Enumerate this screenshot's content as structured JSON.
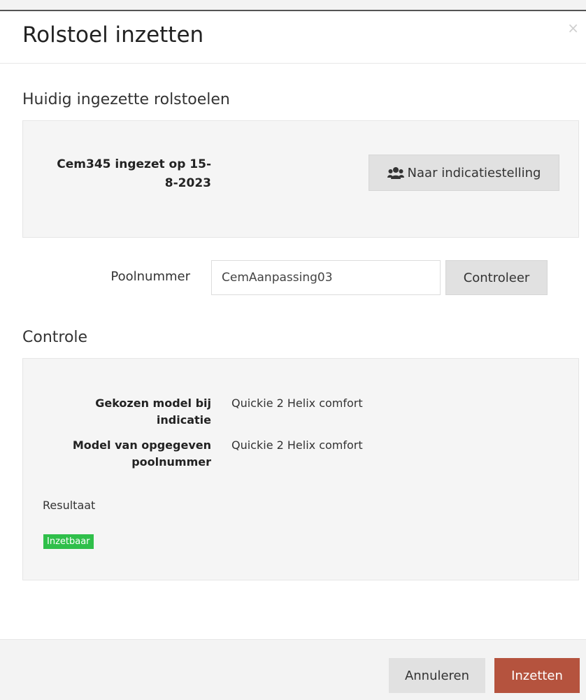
{
  "modal": {
    "title": "Rolstoel inzetten",
    "close_label": "×"
  },
  "current": {
    "section_title": "Huidig ingezette rolstoelen",
    "item_line1": "Cem345 ingezet op 15-",
    "item_line2": "8-2023",
    "indication_button_label": "Naar indicatiestelling",
    "indication_icon": "users-icon"
  },
  "pool": {
    "label": "Poolnummer",
    "value": "CemAanpassing03",
    "check_button_label": "Controleer"
  },
  "check": {
    "section_title": "Controle",
    "chosen_model_label_line1": "Gekozen model bij",
    "chosen_model_label_line2": "indicatie",
    "chosen_model_value": "Quickie 2 Helix comfort",
    "pool_model_label_line1": "Model van opgegeven",
    "pool_model_label_line2": "poolnummer",
    "pool_model_value": "Quickie 2 Helix comfort",
    "result_label": "Resultaat",
    "result_badge": "Inzetbaar",
    "badge_color": "#2fbf4a"
  },
  "footer": {
    "cancel_label": "Annuleren",
    "submit_label": "Inzetten",
    "submit_color": "#b5533e"
  }
}
